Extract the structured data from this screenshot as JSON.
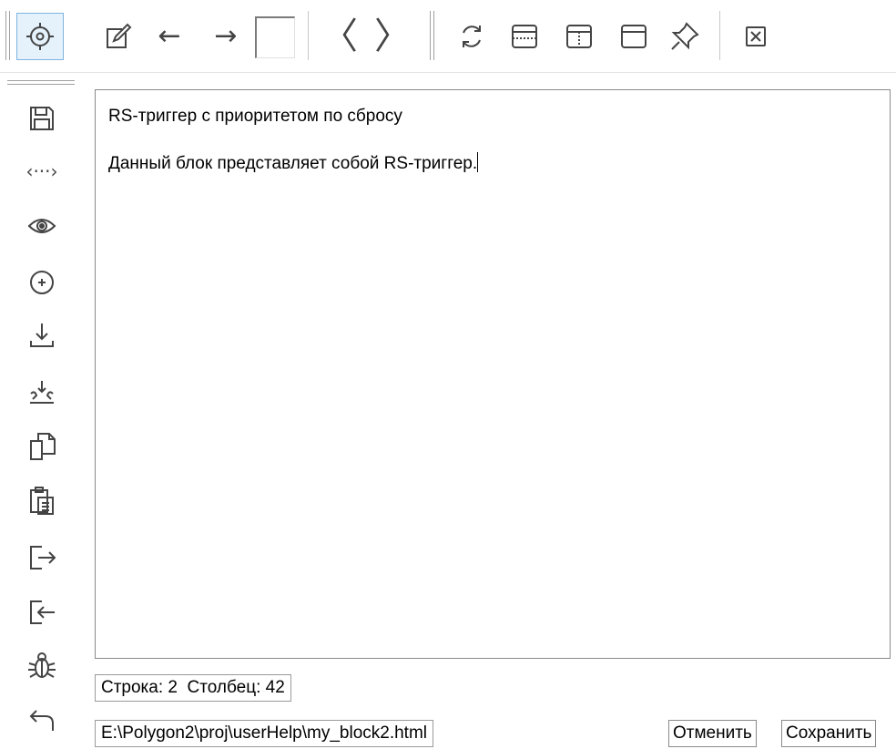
{
  "toolbar": {
    "buttons": [
      {
        "name": "target-icon",
        "active": true
      },
      {
        "name": "edit-icon"
      },
      {
        "name": "arrow-left-icon",
        "glyph": "←"
      },
      {
        "name": "arrow-right-icon",
        "glyph": "→"
      },
      {
        "name": "angle-left-icon",
        "glyph": "〈"
      },
      {
        "name": "angle-right-icon",
        "glyph": "〉"
      },
      {
        "name": "refresh-icon"
      },
      {
        "name": "window-top-icon"
      },
      {
        "name": "window-split-icon"
      },
      {
        "name": "window-tab-icon"
      },
      {
        "name": "pin-icon"
      },
      {
        "name": "close-icon"
      }
    ]
  },
  "sidebar": {
    "icons": [
      "save-icon",
      "code-icon",
      "eye-icon",
      "add-circle-icon",
      "download-icon",
      "import-icon",
      "copy-icon",
      "paste-icon",
      "export-icon",
      "login-icon",
      "bug-icon",
      "undo-icon"
    ]
  },
  "editor": {
    "lines": [
      "RS-триггер с приоритетом по сбросу",
      "",
      "Данный блок представляет собой RS-триггер."
    ]
  },
  "status": {
    "position": "Строка: 2  Столбец: 42",
    "file_path": "E:\\Polygon2\\proj\\userHelp\\my_block2.html"
  },
  "buttons": {
    "cancel_label": "Отменить",
    "save_label": "Сохранить"
  },
  "colors": {
    "active_bg": "#e5f1fb",
    "active_border": "#7fb4de",
    "icon": "#444444"
  }
}
